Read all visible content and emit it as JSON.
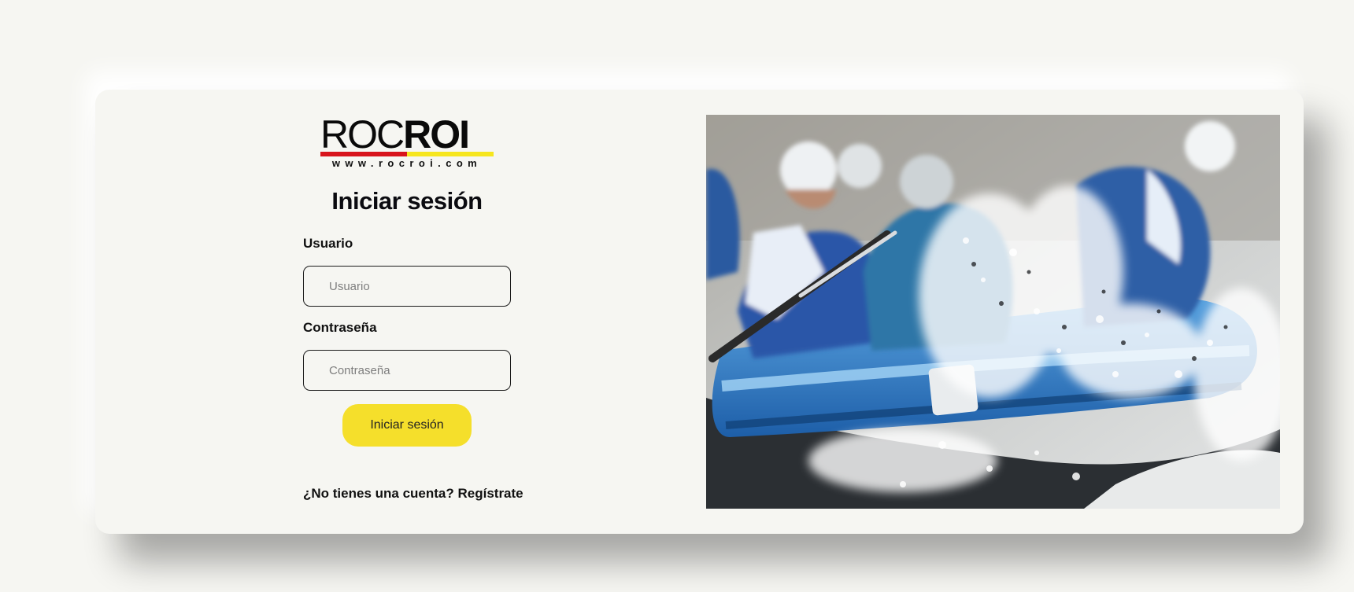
{
  "logo": {
    "roc": "ROC",
    "roi": "ROI",
    "url": "www.rocroi.com",
    "colors": {
      "red": "#d8141c",
      "yellow": "#f6e61e",
      "text": "#0a0a0a"
    }
  },
  "login": {
    "title": "Iniciar sesión",
    "user_label": "Usuario",
    "user_placeholder": "Usuario",
    "password_label": "Contraseña",
    "password_placeholder": "Contraseña",
    "submit_label": "Iniciar sesión",
    "register_prompt": "¿No tienes una cuenta?",
    "register_link": "Regístrate"
  },
  "hero_image": {
    "subject": "rafting-photo"
  },
  "colors": {
    "background": "#f6f6f2",
    "button": "#f5df2b",
    "text": "#111111"
  }
}
